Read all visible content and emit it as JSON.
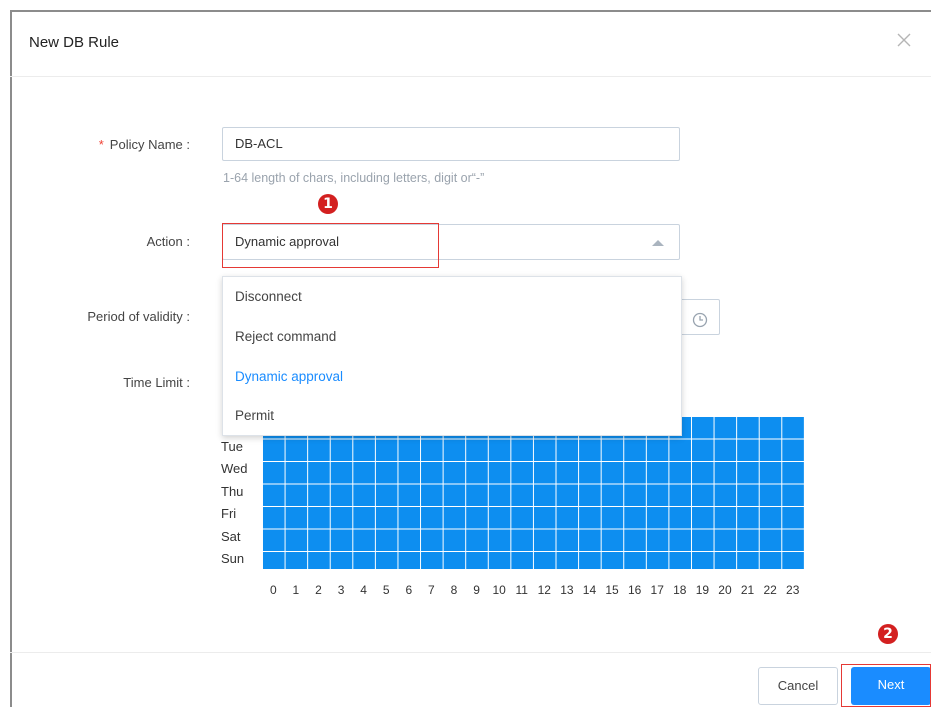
{
  "dialog": {
    "title": "New DB Rule"
  },
  "form": {
    "policy_name": {
      "required_mark": "*",
      "label": "Policy Name :",
      "value": "DB-ACL",
      "hint": "1-64 length of chars, including letters, digit or“-”"
    },
    "action": {
      "label": "Action :",
      "value": "Dynamic approval",
      "options": [
        "Disconnect",
        "Reject command",
        "Dynamic approval",
        "Permit"
      ],
      "selected_index": 2
    },
    "validity": {
      "label": "Period of validity :"
    },
    "time_limit": {
      "label": "Time Limit :",
      "days_visible": [
        "Tue",
        "Wed",
        "Thu",
        "Fri",
        "Sat",
        "Sun"
      ],
      "hours": [
        "0",
        "1",
        "2",
        "3",
        "4",
        "5",
        "6",
        "7",
        "8",
        "9",
        "10",
        "11",
        "12",
        "13",
        "14",
        "15",
        "16",
        "17",
        "18",
        "19",
        "20",
        "21",
        "22",
        "23"
      ],
      "all_selected": true
    }
  },
  "annotations": {
    "step1": "1",
    "step2": "2"
  },
  "footer": {
    "cancel_label": "Cancel",
    "next_label": "Next"
  },
  "colors": {
    "accent": "#1a8cff",
    "grid_fill": "#0d8ef0",
    "highlight": "#e53935"
  }
}
